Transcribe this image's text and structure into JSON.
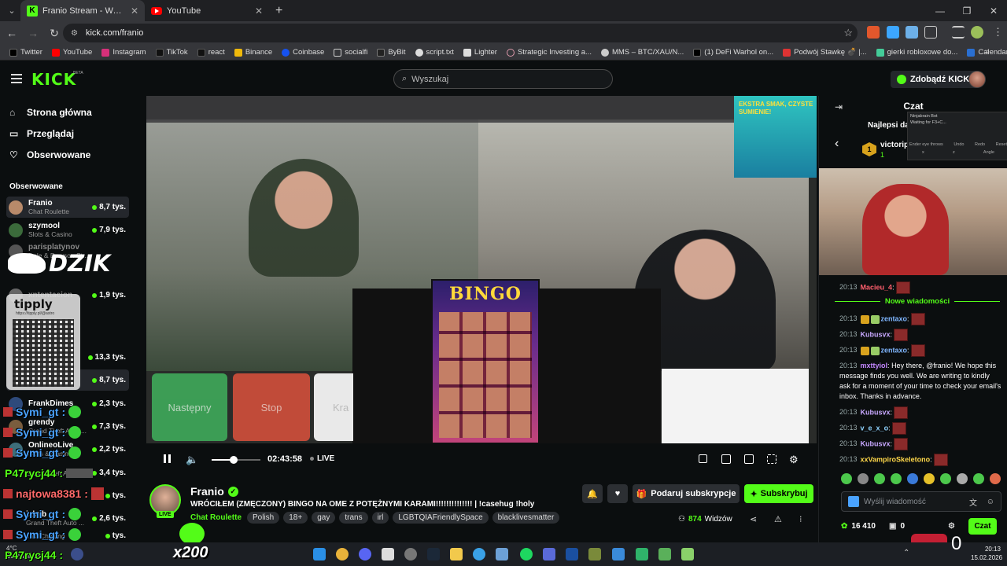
{
  "browser": {
    "tabs": [
      {
        "label": "Franio Stream - Watch Live",
        "active": true
      },
      {
        "label": "YouTube",
        "active": false
      }
    ],
    "url": "kick.com/franio",
    "bookmarks": [
      "Twitter",
      "YouTube",
      "Instagram",
      "TikTok",
      "react",
      "Binance",
      "Coinbase",
      "socialfi",
      "ByBit",
      "script.txt",
      "Lighter",
      "Strategic Investing a...",
      "MMS – BTC/XAU/N...",
      "(1) DeFi Warhol on...",
      "Podwój Stawkę 💣 |...",
      "gierki robloxowe do...",
      "Calendar | Forex Fac..."
    ]
  },
  "header": {
    "logo": "KICK",
    "beta": "BETA",
    "search_placeholder": "Wyszukaj",
    "get_kicks": "Zdobądź KICKs"
  },
  "sidebar": {
    "nav": [
      "Strona główna",
      "Przeglądaj",
      "Obserwowane"
    ],
    "following_heading": "Obserwowane",
    "channels": [
      {
        "name": "Franio",
        "category": "Chat Roulette",
        "viewers": "8,7 tys."
      },
      {
        "name": "szymool",
        "category": "Slots & Casino",
        "viewers": "7,9 tys."
      },
      {
        "name": "parisplatynov",
        "category": "Dale & Dawson St...",
        "viewers": ""
      },
      {
        "name": "xntentacion",
        "category": "",
        "viewers": "1,9 tys."
      },
      {
        "name": "",
        "category": "",
        "viewers": "13,3 tys."
      },
      {
        "name": "",
        "category": "Slots & Casino",
        "viewers": "8,7 tys."
      },
      {
        "name": "FrankDimes",
        "category": "",
        "viewers": "2,3 tys."
      },
      {
        "name": "grendy",
        "category": "Grand Theft Auto ...",
        "viewers": "7,3 tys."
      },
      {
        "name": "OnlineoLive",
        "category": "Slots & Casino",
        "viewers": "2,2 tys."
      },
      {
        "name": "",
        "category": "Grand Theft Auto ...",
        "viewers": "3,4 tys."
      },
      {
        "name": "",
        "category": "",
        "viewers": "tys."
      },
      {
        "name": "jakub",
        "category": "Grand Theft Auto ...",
        "viewers": "2,6 tys."
      },
      {
        "name": "",
        "category": "Just Chatting",
        "viewers": "tys."
      }
    ],
    "overlay_brand": "DZIK",
    "tipply": "tipply",
    "tipply_url": "https://tipply.pl/@astro"
  },
  "overlay_chat": [
    {
      "user": "Symi_gt",
      "suffix": ":"
    },
    {
      "user": "Symi_gt",
      "suffix": ":"
    },
    {
      "user": "Symi_gt",
      "suffix": ":"
    },
    {
      "user": "P47rycj44",
      "suffix": ":"
    },
    {
      "user": "najtowa8381",
      "suffix": ":"
    },
    {
      "user": "Symi_gt",
      "suffix": ":"
    },
    {
      "user": "Symi_gt",
      "suffix": ":"
    },
    {
      "user": "P47rycj44",
      "suffix": ":"
    }
  ],
  "video": {
    "button_next": "Następny",
    "button_stop": "Stop",
    "button_partial": "Kra",
    "bingo": "BINGO",
    "ad_text": "EKSTRA SMAK, CZYSTE SUMIENIE!",
    "timecode": "02:43:58",
    "live": "LIVE",
    "volume_level": 0.45
  },
  "stream": {
    "name": "Franio",
    "live_badge": "LIVE",
    "title": "WRÓCIŁEM (ZMĘCZONY) BINGO NA OME Z POTĘŻNYMI KARAMI!!!!!!!!!!!!!! | !casehug !holy",
    "category": "Chat Roulette",
    "tags": [
      "Polish",
      "18+",
      "gay",
      "trans",
      "irl",
      "LGBTQIAFriendlySpace",
      "blacklivesmatter"
    ],
    "gift_label": "Podaruj subskrypcje",
    "subscribe_label": "Subskrybuj",
    "viewers": "874",
    "viewers_label": "Widzów"
  },
  "chat": {
    "title": "Czat",
    "top_label": "Najlepsi da",
    "top_name": "victorip",
    "top_rank": "1",
    "top_value": "1",
    "ninja": {
      "title": "Ninjabrain Bot",
      "status": "Waiting for F3+C...",
      "cols": [
        "Ender eye throws",
        "Undo",
        "Redo",
        "Reset"
      ],
      "sub": [
        "x",
        "z",
        "Angle"
      ]
    },
    "new_messages_label": "Nowe wiadomości",
    "messages": [
      {
        "time": "20:13",
        "user": "Macieu_4",
        "text": "",
        "color": "#ff5f6d",
        "emote": true,
        "badge": false
      },
      {
        "time": "20:13",
        "user": "zentaxo",
        "text": "",
        "color": "#7fb6ff",
        "emote": true,
        "badge": true
      },
      {
        "time": "20:13",
        "user": "Kubusvx",
        "text": "",
        "color": "#c8a8ff",
        "emote": true,
        "badge": false
      },
      {
        "time": "20:13",
        "user": "zentaxo",
        "text": "",
        "color": "#7fb6ff",
        "emote": true,
        "badge": true
      },
      {
        "time": "20:13",
        "user": "mxttyiol",
        "text": "Hey there, @franio! We hope this message finds you well. We are writing to kindly ask for a moment of your time to check your email's inbox. Thanks in advance.",
        "color": "#c387ff",
        "emote": false,
        "badge": false
      },
      {
        "time": "20:13",
        "user": "Kubusvx",
        "text": "",
        "color": "#c8a8ff",
        "emote": true,
        "badge": false
      },
      {
        "time": "20:13",
        "user": "v_e_x_o",
        "text": "",
        "color": "#8fd3ff",
        "emote": true,
        "badge": false
      },
      {
        "time": "20:13",
        "user": "Kubusvx",
        "text": "",
        "color": "#c8a8ff",
        "emote": true,
        "badge": false
      },
      {
        "time": "20:13",
        "user": "xxVampiroSkeletono",
        "text": "",
        "color": "#ffd84a",
        "emote": true,
        "badge": false
      }
    ],
    "input_placeholder": "Wyślij wiadomość",
    "points": "16 410",
    "gifts": "0",
    "chat_button": "Czat"
  },
  "overlay_misc": {
    "multiplier": "x200",
    "heart_count": "0"
  },
  "taskbar": {
    "weather_temp": "4°C",
    "weather_desc": "Bezchmurnie",
    "time": "20:13",
    "date": "15.02.2026"
  },
  "colors": {
    "kick_green": "#53fc18",
    "background": "#0b0e0f",
    "panel": "#24272c"
  }
}
